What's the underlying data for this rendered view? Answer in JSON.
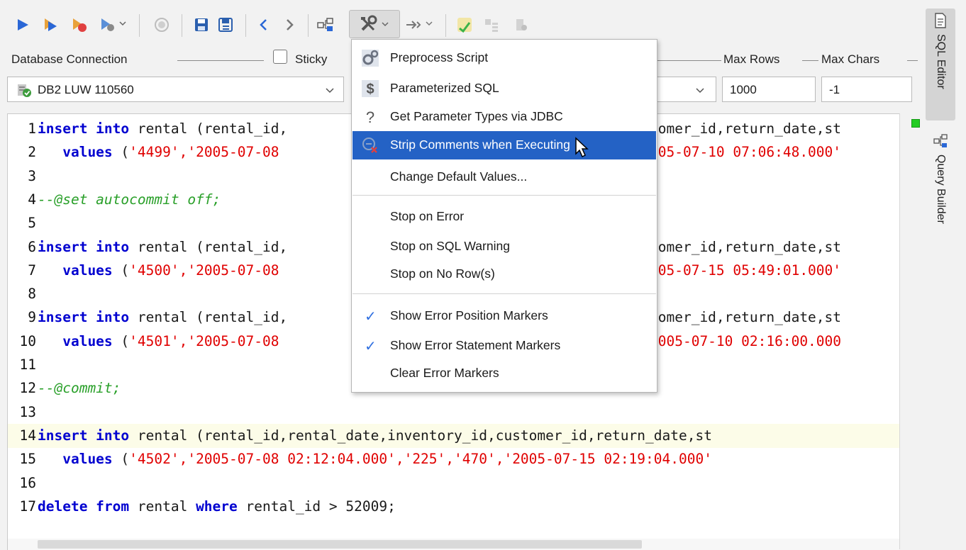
{
  "toolbar": {
    "icons": [
      "run-icon",
      "run-current-icon",
      "run-step-icon",
      "run-options-icon",
      "stop-icon",
      "save-icon",
      "save-as-icon",
      "back-icon",
      "forward-icon",
      "explain-plan-icon",
      "tools-icon",
      "format-icon",
      "commit-icon",
      "table-icon",
      "query-icon"
    ]
  },
  "connection": {
    "group_label": "Database Connection",
    "sticky_label": "Sticky",
    "selected": "DB2 LUW 110560"
  },
  "limits": {
    "max_rows_label": "Max Rows",
    "max_chars_label": "Max Chars",
    "max_rows_value": "1000",
    "max_chars_value": "-1"
  },
  "side_tabs": {
    "sql_editor": "SQL Editor",
    "query_builder": "Query Builder"
  },
  "editor": {
    "lines": [
      {
        "n": "1",
        "p1": "insert into",
        "p2": " rental (rental_id,",
        "p3": "",
        "gap": true,
        "r": "tomer_id,return_date,st"
      },
      {
        "n": "2",
        "p1": "   values",
        "p2": " (",
        "p3": "'4499','2005-07-08",
        "gap": true,
        "r": "005-07-10 07:06:48.000'"
      },
      {
        "n": "3"
      },
      {
        "n": "4",
        "cmt": "--@set autocommit off;"
      },
      {
        "n": "5"
      },
      {
        "n": "6",
        "p1": "insert into",
        "p2": " rental (rental_id,",
        "p3": "",
        "gap": true,
        "r": "tomer_id,return_date,st"
      },
      {
        "n": "7",
        "p1": "   values",
        "p2": " (",
        "p3": "'4500','2005-07-08",
        "gap": true,
        "r": "005-07-15 05:49:01.000'"
      },
      {
        "n": "8"
      },
      {
        "n": "9",
        "p1": "insert into",
        "p2": " rental (rental_id,",
        "p3": "",
        "gap": true,
        "r": "tomer_id,return_date,st"
      },
      {
        "n": "10",
        "p1": "   values",
        "p2": " (",
        "p3": "'4501','2005-07-08",
        "gap": true,
        "r": "2005-07-10 02:16:00.000"
      },
      {
        "n": "11"
      },
      {
        "n": "12",
        "cmt": "--@commit;"
      },
      {
        "n": "13"
      },
      {
        "n": "14",
        "p1": "insert into",
        "p2": " rental (rental_id,rental_date,inventory_id,customer_id,return_date,st",
        "p3": "",
        "hl": true
      },
      {
        "n": "15",
        "p1": "   values",
        "p2": " (",
        "p3": "'4502','2005-07-08 02:12:04.000','225','470','2005-07-15 02:19:04.000'"
      },
      {
        "n": "16"
      },
      {
        "n": "17",
        "p1": "delete from",
        "p2": " rental ",
        "p3": "",
        "kw2": "where",
        "p4": " rental_id > 52009;"
      }
    ]
  },
  "menu": {
    "items": [
      {
        "label": "Preprocess Script",
        "icon": "gears-icon"
      },
      {
        "label": "Parameterized SQL",
        "icon": "dollar-icon"
      },
      {
        "label": "Get Parameter Types via JDBC",
        "icon": "question-icon"
      },
      {
        "label": "Strip Comments when Executing",
        "icon": "strip-comments-icon",
        "selected": true
      },
      {
        "label": "Change Default Values..."
      },
      {
        "label": "Stop on Error"
      },
      {
        "label": "Stop on SQL Warning"
      },
      {
        "label": "Stop on No Row(s)"
      },
      {
        "label": "Show Error Position Markers",
        "checked": true
      },
      {
        "label": "Show Error Statement Markers",
        "checked": true
      },
      {
        "label": "Clear Error Markers"
      }
    ]
  }
}
